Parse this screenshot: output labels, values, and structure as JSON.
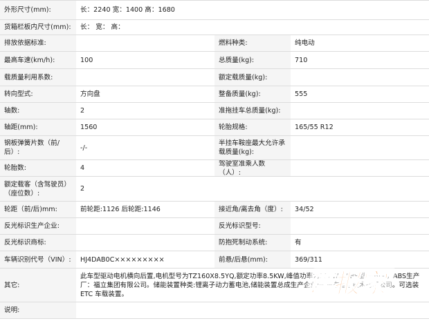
{
  "rows": [
    {
      "label": "外形尺寸(mm):",
      "value": "长：2240 宽：1400 高：1680"
    },
    {
      "label": "货箱栏板内尺寸(mm):",
      "value": "长：  宽：  高："
    },
    {
      "label": "排放依据标准:",
      "value": "",
      "label2": "燃料种类:",
      "value2": "纯电动"
    },
    {
      "label": "最高车速(km/h):",
      "value": "100",
      "label2": "总质量(kg):",
      "value2": "710"
    },
    {
      "label": "载质量利用系数:",
      "value": "",
      "label2": "额定载质量(kg):",
      "value2": ""
    },
    {
      "label": "转向型式:",
      "value": "方向盘",
      "label2": "整备质量(kg):",
      "value2": "555"
    },
    {
      "label": "轴数:",
      "value": "2",
      "label2": "准拖挂车总质量(kg):",
      "value2": ""
    },
    {
      "label": "轴距(mm):",
      "value": "1560",
      "label2": "轮胎规格:",
      "value2": "165/55 R12"
    },
    {
      "label": "钢板弹簧片数（前/后）:",
      "value": "-/-",
      "label2": "半挂车鞍座最大允许承载质量(kg):",
      "value2": ""
    },
    {
      "label": "轮胎数:",
      "value": "4",
      "label2": "驾驶室准乘人数（人）:",
      "value2": ""
    },
    {
      "label": "额定载客（含驾驶员）（座位数）:",
      "value": "2"
    },
    {
      "label": "轮距（前/后)mm:",
      "value": "前轮距:1126 后轮距:1146",
      "label2": "接近角/离去角（度）:",
      "value2": "34/52"
    },
    {
      "label": "反光标识生产企业:",
      "value": "",
      "label2": "反光标识型号:",
      "value2": ""
    },
    {
      "label": "反光标识商标:",
      "value": "",
      "label2": "防抱死制动系统:",
      "value2": "有"
    },
    {
      "label": "车辆识别代号（VIN）:",
      "value": "HJ4DAB0C×××××××××",
      "label2": "前悬/后悬(mm):",
      "value2": "369/311"
    },
    {
      "label": "其它:",
      "value": "此车型驱动电机横向后置,电机型号为TZ160X8.5YQ,额定功率8.5KW,峰值功率为17KW，ABS型号:BL-I，ABS生产厂：福立集团有限公司。储能装置种类:锂离子动力蓄电池,储能装置总成生产企业:赣州市星锂技术有限公司。可选装ETC 车载装置。"
    },
    {
      "label": "说明:",
      "value": ""
    }
  ],
  "watermark": {
    "text": "谍报家",
    "color": "#f07a1a"
  }
}
